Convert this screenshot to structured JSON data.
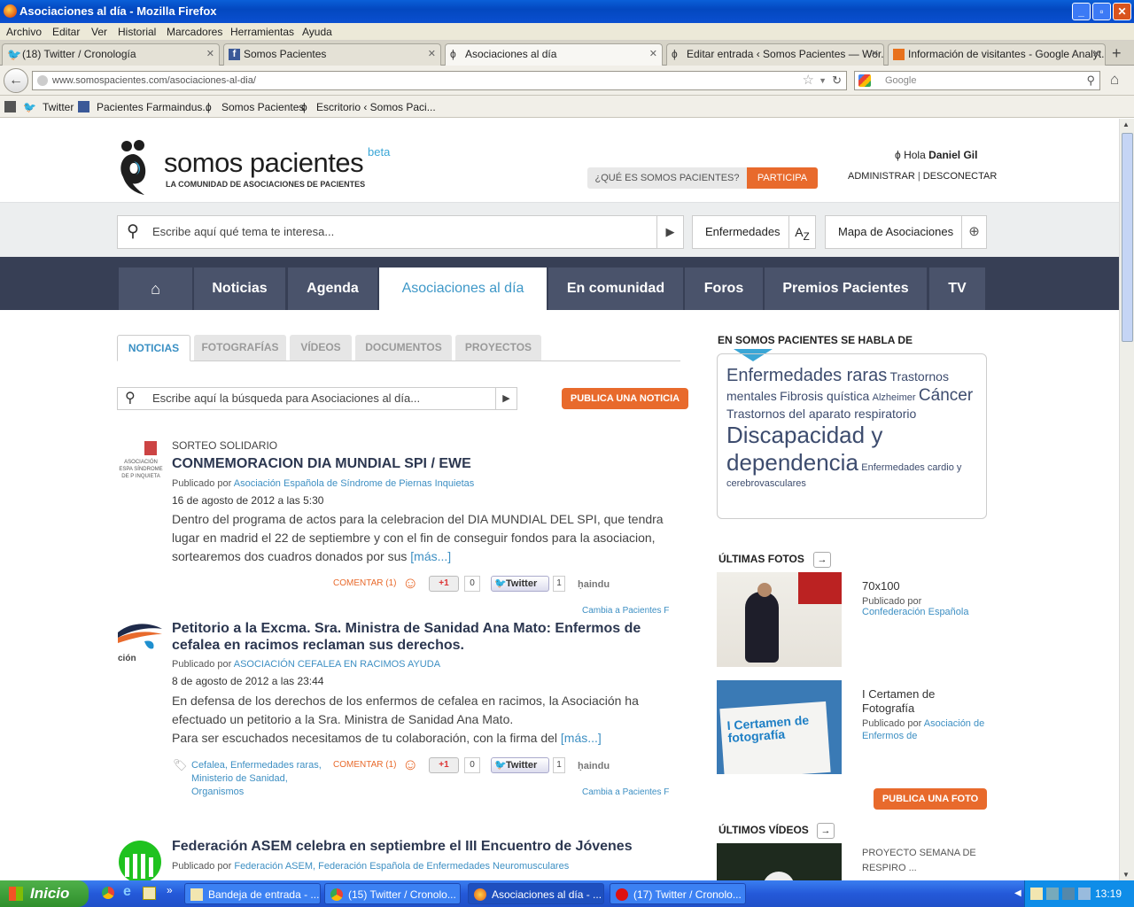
{
  "window": {
    "title": "Asociaciones al día - Mozilla Firefox"
  },
  "menu": [
    "Archivo",
    "Editar",
    "Ver",
    "Historial",
    "Marcadores",
    "Herramientas",
    "Ayuda"
  ],
  "tabs": [
    {
      "label": "(18) Twitter / Cronología"
    },
    {
      "label": "Somos Pacientes"
    },
    {
      "label": "Asociaciones al día"
    },
    {
      "label": "Editar entrada ‹ Somos Pacientes — Wor..."
    },
    {
      "label": "Información de visitantes - Google Analyt..."
    }
  ],
  "url": {
    "host": "www.somospacientes.com",
    "path": "/asociaciones-al-dia/"
  },
  "browser_search": {
    "placeholder": "Google"
  },
  "bookmarks": [
    "Twitter",
    "Pacientes Farmaindus...",
    "Somos Pacientes",
    "Escritorio ‹ Somos Paci..."
  ],
  "site": {
    "logo_text": "somos pacientes",
    "logo_beta": "beta",
    "tagline": "LA COMUNIDAD DE ASOCIACIONES DE PACIENTES",
    "que_es": "¿QUÉ ES SOMOS PACIENTES?",
    "participa": "PARTICIPA",
    "greeting": "Hola",
    "user": "Daniel Gil",
    "admin": "ADMINISTRAR",
    "disconnect": "DESCONECTAR",
    "search_placeholder": "Escribe aquí qué tema te interesa...",
    "enfermedades": "Enfermedades",
    "mapa": "Mapa de Asociaciones",
    "nav": [
      "Noticias",
      "Agenda",
      "Asociaciones al día",
      "En comunidad",
      "Foros",
      "Premios Pacientes",
      "TV"
    ],
    "subtabs": [
      "NOTICIAS",
      "FOTOGRAFÍAS",
      "VÍDEOS",
      "DOCUMENTOS",
      "PROYECTOS"
    ],
    "news_search_placeholder": "Escribe aquí la búsqueda para Asociaciones al día...",
    "publica_noticia": "PUBLICA UNA NOTICIA",
    "posted_by": "Publicado por",
    "comentar": "COMENTAR (1)",
    "gplus": "+1",
    "gplus_count": "0",
    "tweet": "Twitter",
    "tweet_count": "1",
    "cambia": "Cambia a Pacientes F",
    "farma": "ḥaindu",
    "posts": [
      {
        "category": "SORTEO SOLIDARIO",
        "title": "CONMEMORACION DIA MUNDIAL SPI / EWE",
        "author": "Asociación Española de Síndrome de Piernas Inquietas",
        "date": "16 de agosto de 2012 a las 5:30",
        "body": "Dentro del programa de actos para la celebracion del DIA MUNDIAL DEL SPI, que tendra lugar en madrid el 22 de septiembre y con el fin de conseguir fondos para la asociacion, sortearemos dos cuadros donados por sus",
        "more": "[más...]",
        "logo_text": "ASOCIACIÓN ESPA SÍNDROME DE P INQUIETA"
      },
      {
        "category": "",
        "title": "Petitorio a la Excma. Sra. Ministra de Sanidad Ana Mato: Enfermos de cefalea en racimos reclaman sus derechos.",
        "author": "ASOCIACIÓN CEFALEA EN RACIMOS AYUDA",
        "date": "8 de agosto de 2012 a las 23:44",
        "body": "En defensa de los derechos de los enfermos de cefalea en racimos, la Asociación ha efectuado un petitorio a la Sra. Ministra de Sanidad Ana Mato.",
        "body2": "Para ser escuchados necesitamos de tu colaboración, con la firma del",
        "more": "[más...]",
        "tags": "Cefalea, Enfermedades raras, Ministerio de Sanidad, Organismos",
        "logo_text": "ción"
      },
      {
        "category": "",
        "title": "Federación ASEM celebra en septiembre el III Encuentro de Jóvenes",
        "author": "Federación ASEM, Federación Española de Enfermedades Neuromusculares",
        "date": "",
        "body": ""
      }
    ],
    "sidebar": {
      "cloud_title": "EN SOMOS PACIENTES SE HABLA DE",
      "cloud": [
        {
          "t": "Enfermedades raras",
          "s": 20
        },
        {
          "t": "Trastornos mentales",
          "s": 14
        },
        {
          "t": "Fibrosis quística",
          "s": 14
        },
        {
          "t": "Alzheimer",
          "s": 11
        },
        {
          "t": "Cáncer",
          "s": 19
        },
        {
          "t": "Trastornos del aparato respiratorio",
          "s": 14
        },
        {
          "t": "Discapacidad y dependencia",
          "s": 26
        },
        {
          "t": "Enfermedades cardio y cerebrovasculares",
          "s": 11
        }
      ],
      "fotos_title": "ÚLTIMAS FOTOS",
      "photos": [
        {
          "title": "70x100",
          "by": "Confederación Española"
        },
        {
          "title": "I Certamen de Fotografía",
          "by": "Asociación de Enfermos de",
          "overlay": "I Certamen de fotografía"
        }
      ],
      "publica_foto": "PUBLICA UNA FOTO",
      "videos_title": "ÚLTIMOS VÍDEOS",
      "video": {
        "title": "PROYECTO SEMANA DE RESPIRO ..."
      }
    }
  },
  "taskbar": {
    "start": "Inicio",
    "tasks": [
      "Bandeja de entrada - ...",
      "(15) Twitter / Cronolo...",
      "Asociaciones al día - ...",
      "(17) Twitter / Cronolo..."
    ],
    "clock": "13:19"
  },
  "colors": {
    "accent": "#e86a2c",
    "nav_bg": "#373f55",
    "link": "#3d8fc3",
    "tab_active": "#3e98c8"
  }
}
